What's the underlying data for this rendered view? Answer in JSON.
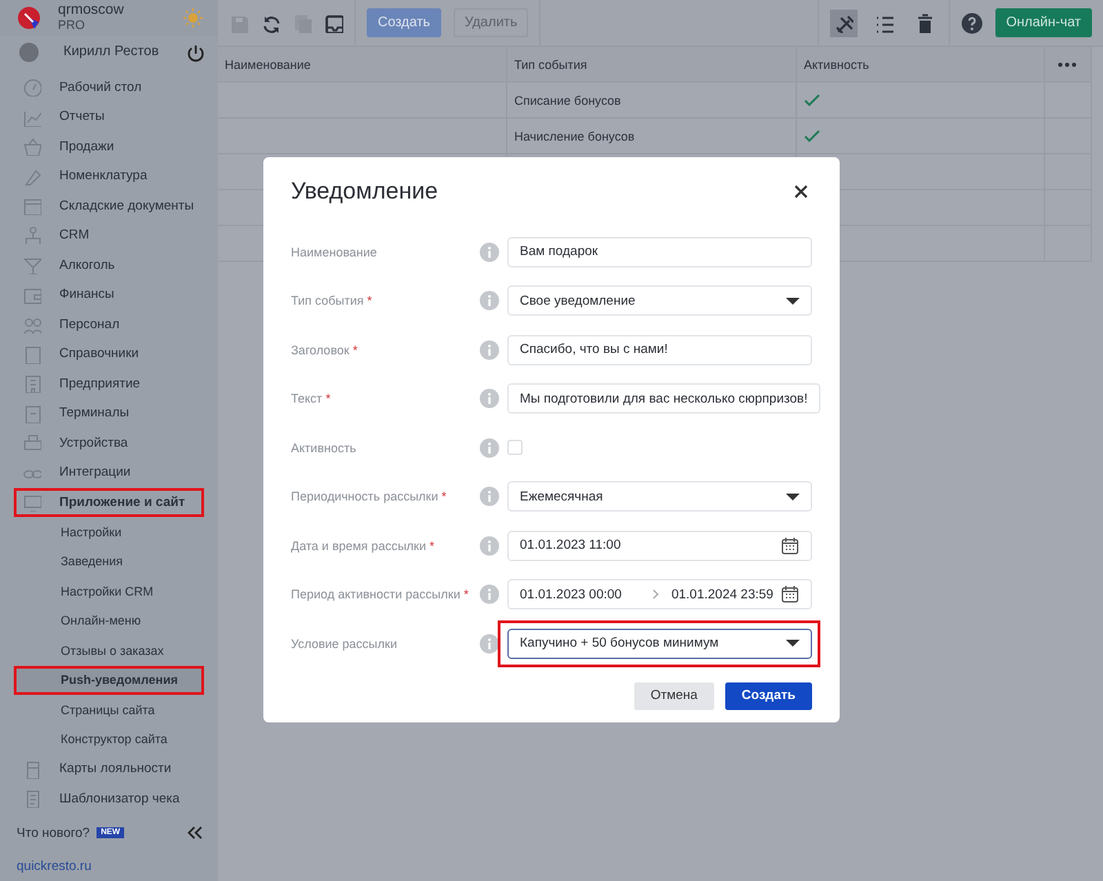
{
  "brand": {
    "name": "qrmoscow",
    "plan": "PRO"
  },
  "user": {
    "name": "Кирилл Рестов"
  },
  "sidebar": {
    "items": [
      {
        "label": "Рабочий стол",
        "selected": false,
        "highlighted": false
      },
      {
        "label": "Отчеты",
        "selected": false,
        "highlighted": false
      },
      {
        "label": "Продажи",
        "selected": false,
        "highlighted": false
      },
      {
        "label": "Номенклатура",
        "selected": false,
        "highlighted": false
      },
      {
        "label": "Складские документы",
        "selected": false,
        "highlighted": false
      },
      {
        "label": "CRM",
        "selected": false,
        "highlighted": false
      },
      {
        "label": "Алкоголь",
        "selected": false,
        "highlighted": false
      },
      {
        "label": "Финансы",
        "selected": false,
        "highlighted": false
      },
      {
        "label": "Персонал",
        "selected": false,
        "highlighted": false
      },
      {
        "label": "Справочники",
        "selected": false,
        "highlighted": false
      },
      {
        "label": "Предприятие",
        "selected": false,
        "highlighted": false
      },
      {
        "label": "Терминалы",
        "selected": false,
        "highlighted": false
      },
      {
        "label": "Устройства",
        "selected": false,
        "highlighted": false
      },
      {
        "label": "Интеграции",
        "selected": false,
        "highlighted": false
      },
      {
        "label": "Приложение и сайт",
        "selected": false,
        "highlighted": true,
        "children": [
          {
            "label": "Настройки",
            "selected": false,
            "highlighted": false
          },
          {
            "label": "Заведения",
            "selected": false,
            "highlighted": false
          },
          {
            "label": "Настройки CRM",
            "selected": false,
            "highlighted": false
          },
          {
            "label": "Онлайн-меню",
            "selected": false,
            "highlighted": false
          },
          {
            "label": "Отзывы о заказах",
            "selected": false,
            "highlighted": false
          },
          {
            "label": "Push-уведомления",
            "selected": true,
            "highlighted": true
          },
          {
            "label": "Страницы сайта",
            "selected": false,
            "highlighted": false
          },
          {
            "label": "Конструктор сайта",
            "selected": false,
            "highlighted": false
          }
        ]
      },
      {
        "label": "Карты лояльности",
        "selected": false,
        "highlighted": false
      },
      {
        "label": "Шаблонизатор чека",
        "selected": false,
        "highlighted": false
      }
    ]
  },
  "whats_new": {
    "label": "Что нового?",
    "badge": "NEW"
  },
  "site_link": "quickresto.ru",
  "toolbar": {
    "icons": [
      {
        "kind": "save",
        "disabled": true
      },
      {
        "kind": "refresh",
        "disabled": false
      },
      {
        "kind": "copy",
        "disabled": true
      },
      {
        "kind": "inbox",
        "disabled": false
      }
    ],
    "buttons": [
      {
        "label": "Создать",
        "kind": "primary",
        "disabled": false
      },
      {
        "label": "Удалить",
        "kind": "outline",
        "disabled": true
      }
    ],
    "right_icons": [
      {
        "kind": "tools",
        "selected": true
      },
      {
        "kind": "list",
        "selected": false
      },
      {
        "kind": "trash",
        "selected": false
      }
    ],
    "chat_button": "Онлайн-чат"
  },
  "table": {
    "columns": [
      "Наименование",
      "Тип события",
      "Активность"
    ],
    "rows": [
      {
        "type": "Списание бонусов",
        "active": true
      },
      {
        "type": "Начисление бонусов",
        "active": true
      }
    ]
  },
  "dialog": {
    "title": "Уведомление",
    "fields": [
      {
        "label": "Наименование",
        "kind": "text",
        "value": "Вам подарок",
        "highlighted": false
      },
      {
        "label": "Тип события",
        "required_mark": "*",
        "kind": "select",
        "value": "Свое уведомление",
        "highlighted": false
      },
      {
        "label": "Заголовок",
        "required_mark": "*",
        "kind": "text",
        "value": "Спасибо, что вы с нами!",
        "highlighted": false
      },
      {
        "label": "Текст",
        "required_mark": "*",
        "kind": "text",
        "value": "Мы подготовили для вас несколько сюрпризов!",
        "highlighted": false
      },
      {
        "label": "Активность",
        "kind": "checkbox",
        "checked": false,
        "highlighted": false
      },
      {
        "label": "Периодичность рассылки",
        "required_mark": "*",
        "kind": "select",
        "value": "Ежемесячная",
        "highlighted": false
      },
      {
        "label": "Дата и время рассылки",
        "required_mark": "*",
        "kind": "date",
        "value": "01.01.2023 11:00",
        "highlighted": false
      },
      {
        "label": "Период активности рассылки",
        "required_mark": "*",
        "kind": "daterange",
        "from": "01.01.2023 00:00",
        "to": "01.01.2024 23:59",
        "highlighted": false
      },
      {
        "label": "Условие рассылки",
        "kind": "select",
        "value": "Капучино + 50 бонусов минимум",
        "highlighted": true
      }
    ],
    "buttons": [
      {
        "label": "Отмена",
        "kind": "secondary"
      },
      {
        "label": "Создать",
        "kind": "primary"
      }
    ]
  }
}
